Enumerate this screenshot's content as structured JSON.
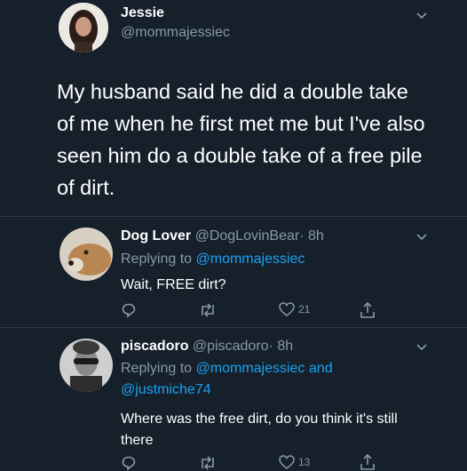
{
  "main_tweet": {
    "name": "Jessie",
    "handle": "@mommajessiec",
    "text": "My husband said he did a double take of me when he first met me but I've also seen him do a double take of a free pile of dirt."
  },
  "replies": [
    {
      "name": "Dog Lover",
      "handle": "@DogLovinBear",
      "time": "· 8h",
      "replying_label": "Replying to",
      "replying_users": "@mommajessiec",
      "text": "Wait, FREE dirt?",
      "likes": "21"
    },
    {
      "name": "piscadoro",
      "handle": "@piscadoro",
      "time": "· 8h",
      "replying_label": "Replying to",
      "replying_users_1": "@mommajessiec",
      "replying_and": "and",
      "replying_users_2": "@justmiche74",
      "text": "Where was the free dirt, do you think it's still there",
      "likes": "13"
    }
  ],
  "colors": {
    "background": "#15202b",
    "link": "#1da1f2",
    "muted": "#8899a6"
  },
  "icons": [
    "chevron-down-icon",
    "reply-icon",
    "retweet-icon",
    "like-icon",
    "share-icon"
  ]
}
